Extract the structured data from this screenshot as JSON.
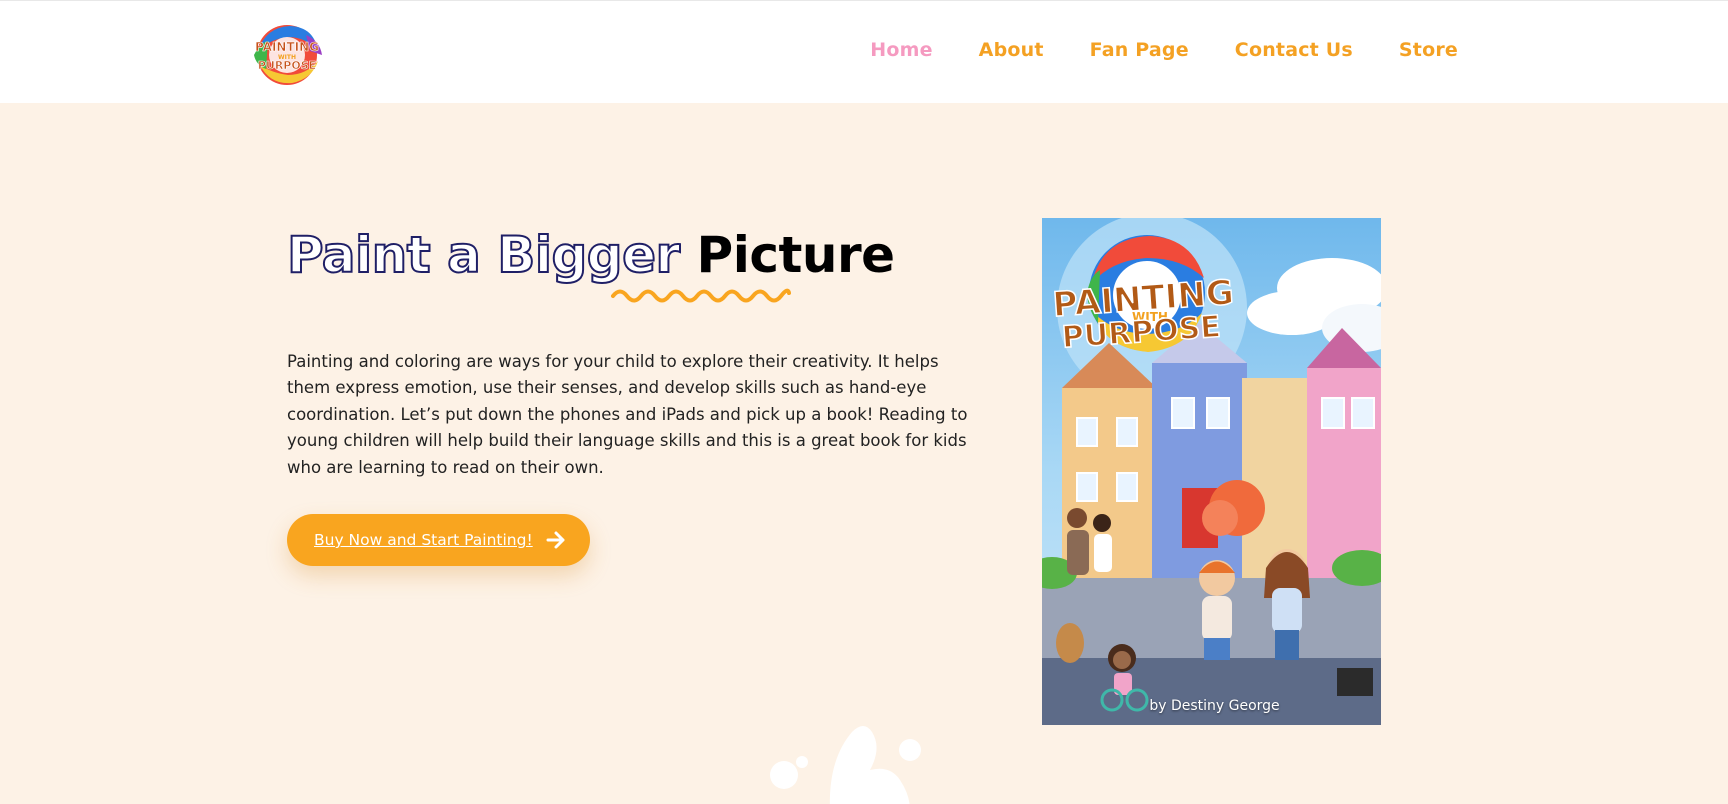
{
  "header": {
    "logo_text": [
      "PAINTING",
      "WITH",
      "PURPOSE"
    ],
    "nav": [
      {
        "label": "Home",
        "active": true
      },
      {
        "label": "About",
        "active": false
      },
      {
        "label": "Fan Page",
        "active": false
      },
      {
        "label": "Contact Us",
        "active": false
      },
      {
        "label": "Store",
        "active": false
      }
    ]
  },
  "hero": {
    "headline_outline": "Paint a Bigger ",
    "headline_solid": "Picture",
    "intro": "Painting and coloring are ways for your child to explore their creativity. It helps them express emotion, use their senses, and develop skills such as hand-eye coordination. Let’s put down the phones and iPads and pick up a book! Reading to young children will help build their language skills and this is a great book for kids who are learning to read on their own.",
    "cta_label": "Buy Now and Start Painting!",
    "cta_icon": "arrow-right-icon"
  },
  "book": {
    "title_lines": [
      "PAINTING",
      "WITH",
      "PURPOSE"
    ],
    "author": "by Destiny George"
  },
  "colors": {
    "background": "#fdf2e6",
    "nav": "#f4a123",
    "nav_active": "#f59ac0",
    "cta": "#f9a51f",
    "headline_outline": "#1f1f66"
  }
}
